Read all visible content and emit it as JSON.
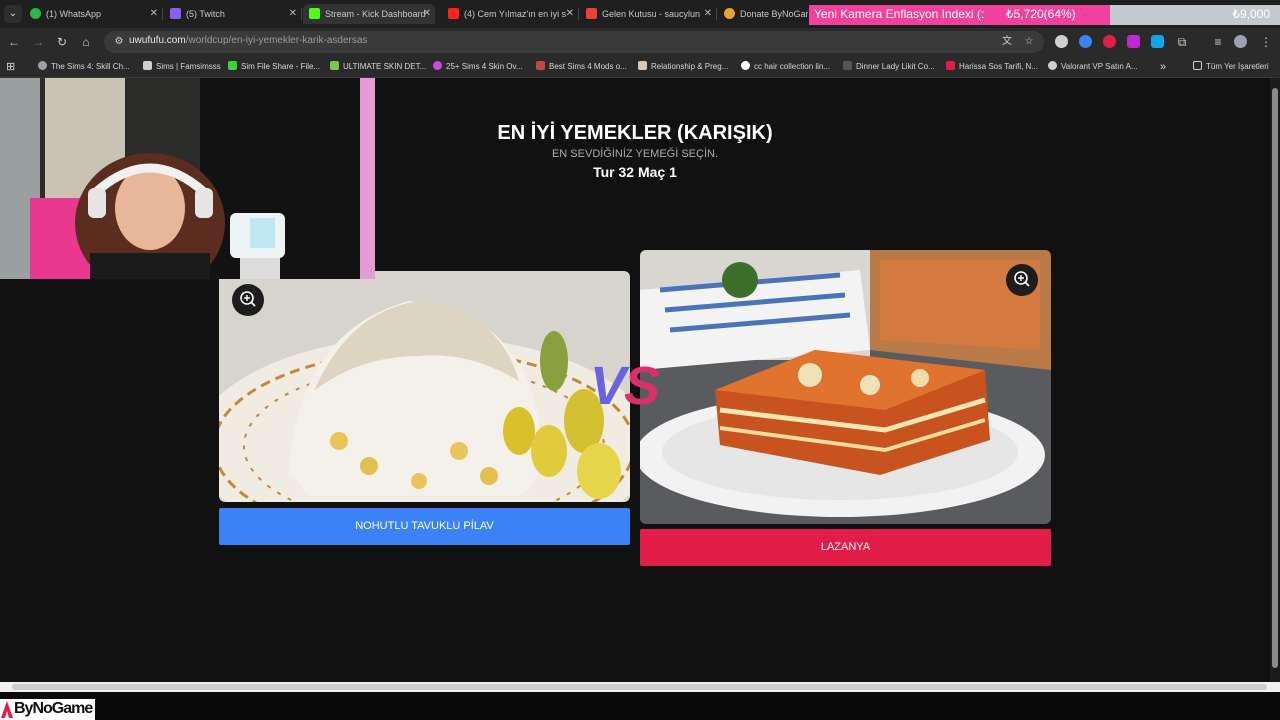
{
  "browser": {
    "tabs": [
      {
        "label": "(1) WhatsApp",
        "fav": "#2bb741"
      },
      {
        "label": "(5) Twitch",
        "fav": "#8b5cf6"
      },
      {
        "label": "Stream - Kick Dashboard",
        "fav": "#53fc18"
      },
      {
        "label": "(4) Cem Yılmaz'ın en iyi s",
        "fav": "#ff2020"
      },
      {
        "label": "Gelen Kutusu - saucylun",
        "fav": "#ea4335"
      },
      {
        "label": "Donate ByNoGame",
        "fav": "#e8a33d"
      }
    ],
    "url_host": "uwufufu.com",
    "url_path": "/worldcup/en-iyi-yemekler-karik-asdersas",
    "bookmarks": [
      {
        "label": "The Sims 4: Skill Ch...",
        "fav": "#9aa0a6"
      },
      {
        "label": "Sims | Famsimsss",
        "fav": "#cfcfcf"
      },
      {
        "label": "Sim File Share - File...",
        "fav": "#3bd33b"
      },
      {
        "label": "ULTIMATE SKIN DET...",
        "fav": "#7ac943"
      },
      {
        "label": "25+ Sims 4 Skin Ov...",
        "fav": "#c64fd6"
      },
      {
        "label": "Best Sims 4 Mods o...",
        "fav": "#b84a4a"
      },
      {
        "label": "Relationship & Preg...",
        "fav": "#d8c7b5"
      },
      {
        "label": "cc hair collection lin...",
        "fav": "#ffffff"
      },
      {
        "label": "Dinner Lady Likit Co...",
        "fav": "#555555"
      },
      {
        "label": "Harissa Sos Tarifi, N...",
        "fav": "#e11d48"
      },
      {
        "label": "Valorant VP Satın A...",
        "fav": "#cfcfcf"
      }
    ],
    "all_bookmarks": "Tüm Yer İşaretleri",
    "more_icon": "»"
  },
  "overlay": {
    "label": "Yeni Kamera Enflasyon Indexi (:",
    "value": "₺5,720(64%)",
    "goal": "₺9,000",
    "progress": 0.64,
    "logo": "ByNoGame"
  },
  "game": {
    "title": "EN İYİ YEMEKLER (KARIŞIK)",
    "subtitle": "EN SEVDİĞİNİZ YEMEĞİ SEÇİN.",
    "round": "Tur 32 Maç 1",
    "vs_v": "V",
    "vs_s": "S",
    "left_choice": "NOHUTLU TAVUKLU PİLAV",
    "right_choice": "LAZANYA",
    "left_color": "#3b82f6",
    "right_color": "#e11d48"
  }
}
